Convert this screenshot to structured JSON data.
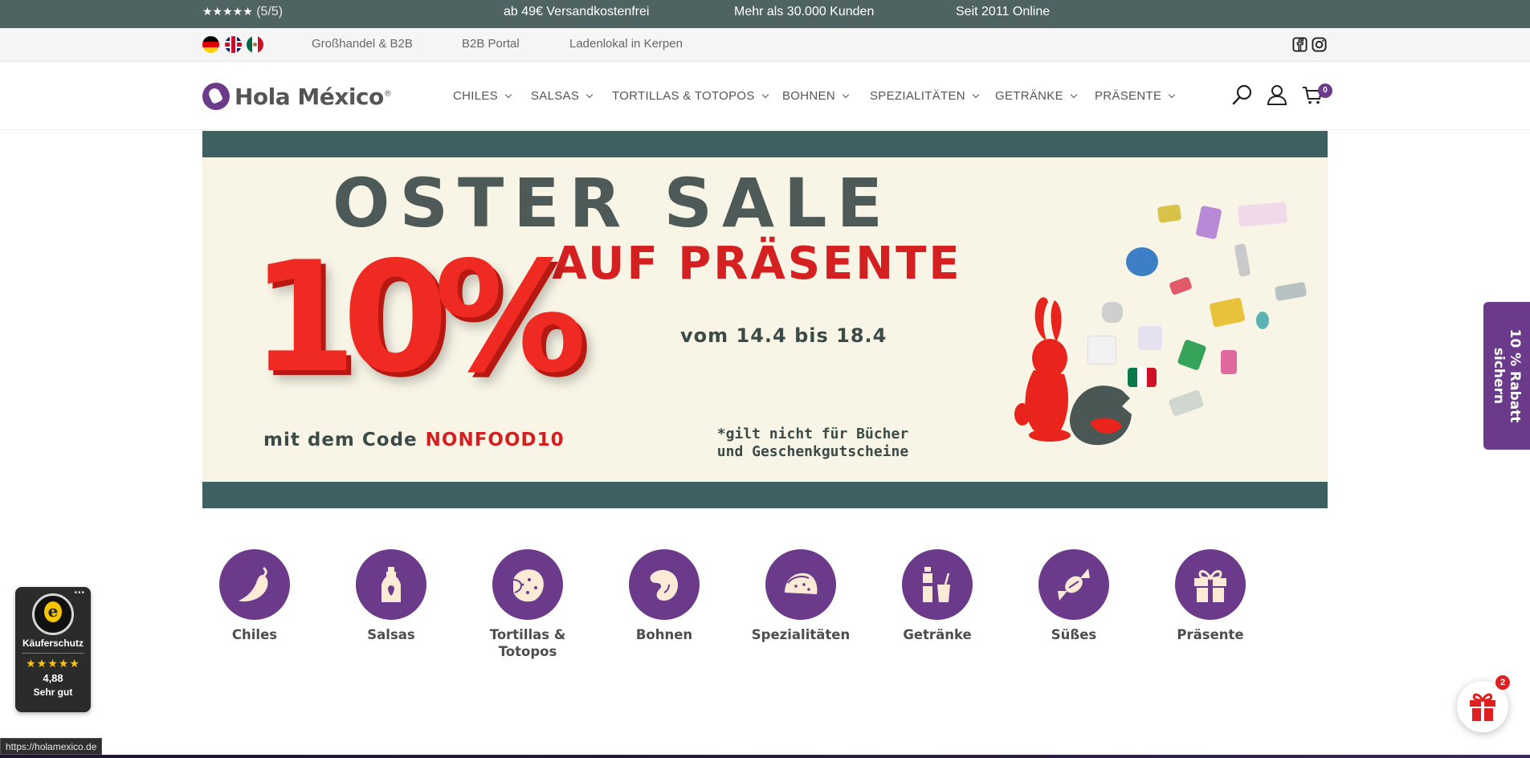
{
  "topbar": {
    "stars": "★★★★★",
    "rating": "(5/5)",
    "shipping": "ab 49€ Versandkostenfrei",
    "customers": "Mehr als 30.000 Kunden",
    "since": "Seit 2011 Online"
  },
  "subbar": {
    "links": [
      "Großhandel & B2B",
      "B2B Portal",
      "Ladenlokal in Kerpen"
    ],
    "languages": [
      "de-flag",
      "uk-flag",
      "mx-flag"
    ],
    "social_icons": [
      "facebook-icon",
      "instagram-icon"
    ]
  },
  "header": {
    "logo_text": "Hola México",
    "logo_mark": "®",
    "nav": [
      "CHILES",
      "SALSAS",
      "TORTILLAS & TOTOPOS",
      "BOHNEN",
      "SPEZIALITÄTEN",
      "GETRÄNKE",
      "PRÄSENTE"
    ],
    "icons": [
      "search-icon",
      "user-icon",
      "cart-icon"
    ],
    "cart_count": "0"
  },
  "hero": {
    "title": "OSTER SALE",
    "subtitle": "AUF PRÄSENTE",
    "percent": "10%",
    "date": "vom 14.4 bis 18.4",
    "code_prefix": "mit dem Code",
    "code": "NONFOOD10",
    "note_line1": "*gilt nicht für Bücher",
    "note_line2": "und  Geschenkgutscheine",
    "colors": {
      "frame": "#3e6060",
      "background": "#f8f5e6",
      "accent": "#d42020"
    }
  },
  "categories": [
    {
      "label": "Chiles",
      "icon": "chili-icon"
    },
    {
      "label": "Salsas",
      "icon": "bottle-icon"
    },
    {
      "label": "Tortillas & Totopos",
      "icon": "tortilla-icon"
    },
    {
      "label": "Bohnen",
      "icon": "bean-icon"
    },
    {
      "label": "Spezialitäten",
      "icon": "taco-icon"
    },
    {
      "label": "Getränke",
      "icon": "drinks-icon"
    },
    {
      "label": "Süßes",
      "icon": "candy-icon"
    },
    {
      "label": "Präsente",
      "icon": "gift-icon"
    }
  ],
  "trustbadge": {
    "label": "Käuferschutz",
    "stars": "★★★★★",
    "score": "4,88",
    "rating_text": "Sehr gut"
  },
  "sidetab": {
    "line1": "10 % Rabatt",
    "line2": "sichern"
  },
  "gift_bubble": {
    "count": "2"
  },
  "status_url": "https://holamexico.de",
  "colors": {
    "brand": "#6b3a8a",
    "topbar": "#4e6362"
  }
}
